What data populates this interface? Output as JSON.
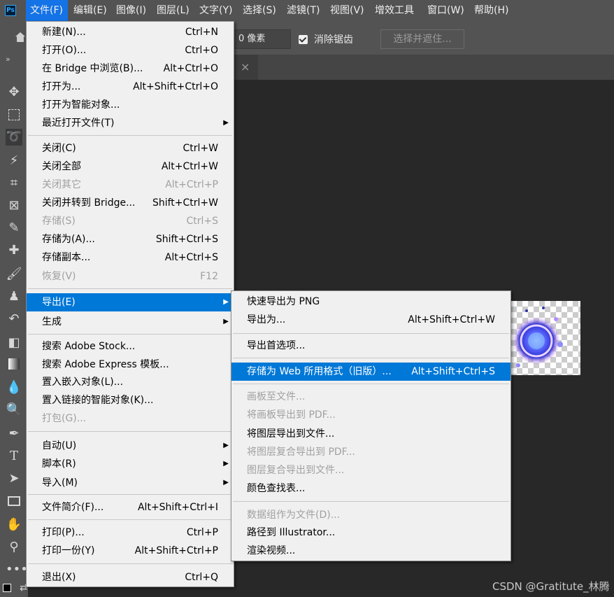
{
  "app": {
    "logo": "Ps"
  },
  "menubar": [
    {
      "label": "文件(F)",
      "active": true
    },
    {
      "label": "编辑(E)"
    },
    {
      "label": "图像(I)"
    },
    {
      "label": "图层(L)"
    },
    {
      "label": "文字(Y)"
    },
    {
      "label": "选择(S)"
    },
    {
      "label": "滤镜(T)"
    },
    {
      "label": "视图(V)"
    },
    {
      "label": "增效工具"
    },
    {
      "label": "窗口(W)"
    },
    {
      "label": "帮助(H)"
    }
  ],
  "options": {
    "feather_value": "0 像素",
    "antialias_label": "消除锯齿",
    "select_mask_label": "选择并遮住..."
  },
  "tabbar": {
    "close_glyph": "×",
    "collapse_glyph": "»"
  },
  "toolbar": {
    "tools": [
      "move-icon",
      "marquee-icon",
      "lasso-icon",
      "magic-wand-icon",
      "crop-icon",
      "frame-icon",
      "eyedropper-icon",
      "healing-icon",
      "brush-icon",
      "stamp-icon",
      "history-brush-icon",
      "eraser-icon",
      "gradient-icon",
      "blur-icon",
      "dodge-icon",
      "pen-icon",
      "type-icon",
      "path-select-icon",
      "rectangle-icon",
      "hand-icon",
      "zoom-icon",
      "more-icon"
    ]
  },
  "file_menu": {
    "items": [
      {
        "label": "新建(N)...",
        "shortcut": "Ctrl+N"
      },
      {
        "label": "打开(O)...",
        "shortcut": "Ctrl+O"
      },
      {
        "label": "在 Bridge 中浏览(B)...",
        "shortcut": "Alt+Ctrl+O"
      },
      {
        "label": "打开为...",
        "shortcut": "Alt+Shift+Ctrl+O"
      },
      {
        "label": "打开为智能对象...",
        "shortcut": ""
      },
      {
        "label": "最近打开文件(T)",
        "shortcut": "",
        "submenu": true
      },
      {
        "separator": true
      },
      {
        "label": "关闭(C)",
        "shortcut": "Ctrl+W"
      },
      {
        "label": "关闭全部",
        "shortcut": "Alt+Ctrl+W"
      },
      {
        "label": "关闭其它",
        "shortcut": "Alt+Ctrl+P",
        "disabled": true
      },
      {
        "label": "关闭并转到 Bridge...",
        "shortcut": "Shift+Ctrl+W"
      },
      {
        "label": "存储(S)",
        "shortcut": "Ctrl+S",
        "disabled": true
      },
      {
        "label": "存储为(A)...",
        "shortcut": "Shift+Ctrl+S"
      },
      {
        "label": "存储副本...",
        "shortcut": "Alt+Ctrl+S"
      },
      {
        "label": "恢复(V)",
        "shortcut": "F12",
        "disabled": true
      },
      {
        "separator": true
      },
      {
        "label": "导出(E)",
        "shortcut": "",
        "submenu": true,
        "highlighted": true
      },
      {
        "label": "生成",
        "shortcut": "",
        "submenu": true
      },
      {
        "separator": true
      },
      {
        "label": "搜索 Adobe Stock...",
        "shortcut": ""
      },
      {
        "label": "搜索 Adobe Express 模板...",
        "shortcut": ""
      },
      {
        "label": "置入嵌入对象(L)...",
        "shortcut": ""
      },
      {
        "label": "置入链接的智能对象(K)...",
        "shortcut": ""
      },
      {
        "label": "打包(G)...",
        "shortcut": "",
        "disabled": true
      },
      {
        "separator": true
      },
      {
        "label": "自动(U)",
        "shortcut": "",
        "submenu": true
      },
      {
        "label": "脚本(R)",
        "shortcut": "",
        "submenu": true
      },
      {
        "label": "导入(M)",
        "shortcut": "",
        "submenu": true
      },
      {
        "separator": true
      },
      {
        "label": "文件简介(F)...",
        "shortcut": "Alt+Shift+Ctrl+I"
      },
      {
        "separator": true
      },
      {
        "label": "打印(P)...",
        "shortcut": "Ctrl+P"
      },
      {
        "label": "打印一份(Y)",
        "shortcut": "Alt+Shift+Ctrl+P"
      },
      {
        "separator": true
      },
      {
        "label": "退出(X)",
        "shortcut": "Ctrl+Q"
      }
    ]
  },
  "export_menu": {
    "items": [
      {
        "label": "快速导出为 PNG",
        "shortcut": ""
      },
      {
        "label": "导出为...",
        "shortcut": "Alt+Shift+Ctrl+W"
      },
      {
        "separator": true
      },
      {
        "label": "导出首选项...",
        "shortcut": ""
      },
      {
        "separator": true
      },
      {
        "label": "存储为 Web 所用格式（旧版）...",
        "shortcut": "Alt+Shift+Ctrl+S",
        "highlighted": true
      },
      {
        "separator": true
      },
      {
        "label": "画板至文件...",
        "shortcut": "",
        "disabled": true
      },
      {
        "label": "将画板导出到 PDF...",
        "shortcut": "",
        "disabled": true
      },
      {
        "label": "将图层导出到文件...",
        "shortcut": ""
      },
      {
        "label": "将图层复合导出到 PDF...",
        "shortcut": "",
        "disabled": true
      },
      {
        "label": "图层复合导出到文件...",
        "shortcut": "",
        "disabled": true
      },
      {
        "label": "颜色查找表...",
        "shortcut": ""
      },
      {
        "separator": true
      },
      {
        "label": "数据组作为文件(D)...",
        "shortcut": "",
        "disabled": true
      },
      {
        "label": "路径到 Illustrator...",
        "shortcut": ""
      },
      {
        "label": "渲染视频...",
        "shortcut": ""
      }
    ]
  },
  "watermark": "CSDN @Gratitute_林腾"
}
